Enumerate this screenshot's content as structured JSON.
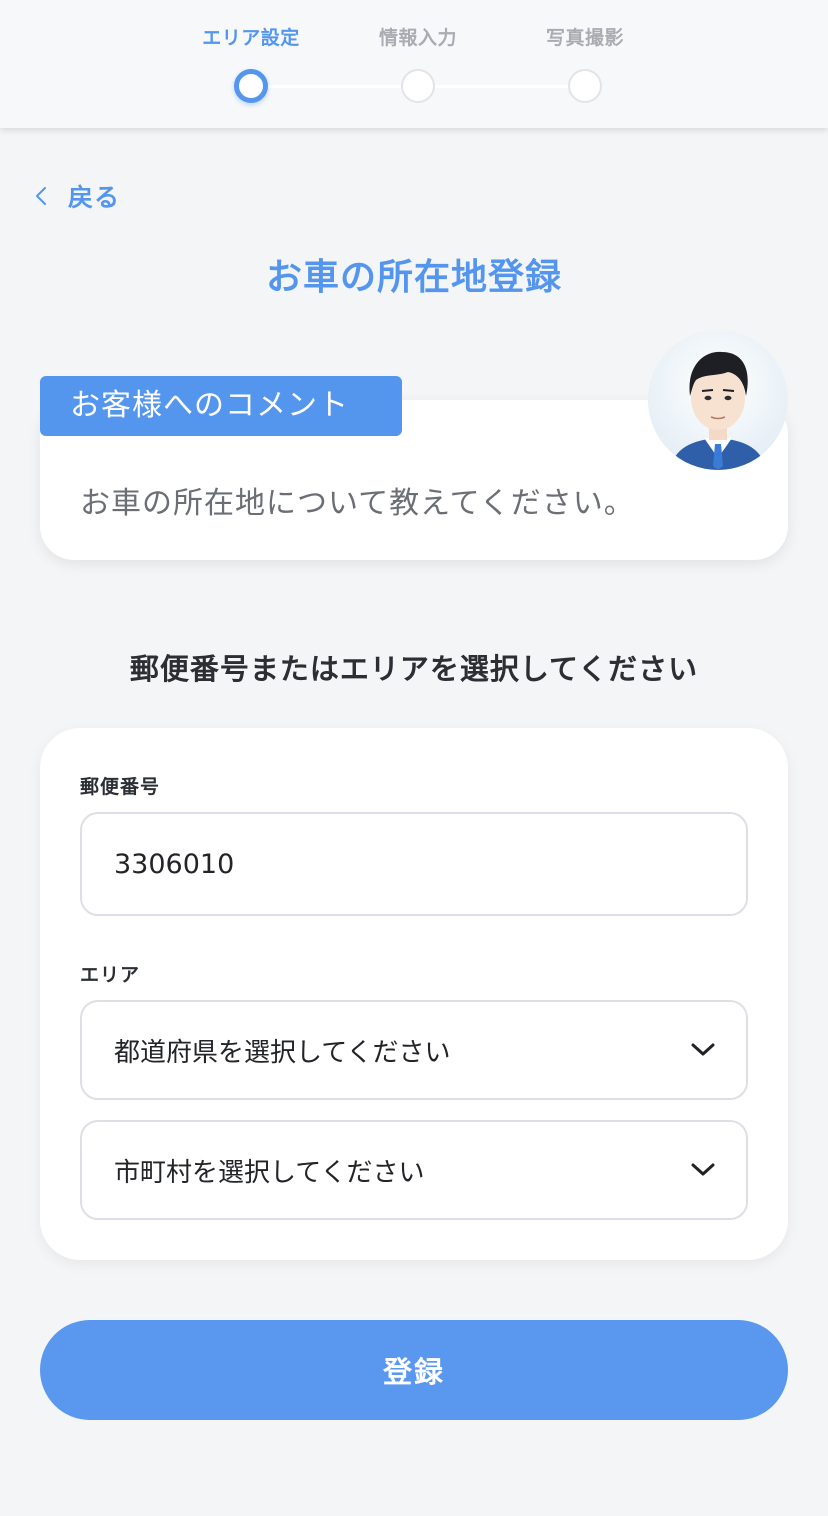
{
  "stepper": {
    "steps": [
      {
        "label": "エリア設定",
        "state": "active"
      },
      {
        "label": "情報入力",
        "state": "inactive"
      },
      {
        "label": "写真撮影",
        "state": "inactive"
      }
    ]
  },
  "nav": {
    "back_label": "戻る",
    "back_icon": "chevron-left-icon"
  },
  "page_title": "お車の所在地登録",
  "comment": {
    "tag": "お客様へのコメント",
    "text": "お車の所在地について教えてください。",
    "avatar": "staff-avatar"
  },
  "section_heading": "郵便番号またはエリアを選択してください",
  "form": {
    "postal_label": "郵便番号",
    "postal_value": "3306010",
    "area_label": "エリア",
    "prefecture_placeholder": "都道府県を選択してください",
    "city_placeholder": "市町村を選択してください",
    "select_icon": "chevron-down-icon"
  },
  "submit_label": "登録",
  "colors": {
    "accent": "#5496ee",
    "button": "#5a98f0",
    "background": "#f4f5f7",
    "text": "#2b2f34"
  }
}
